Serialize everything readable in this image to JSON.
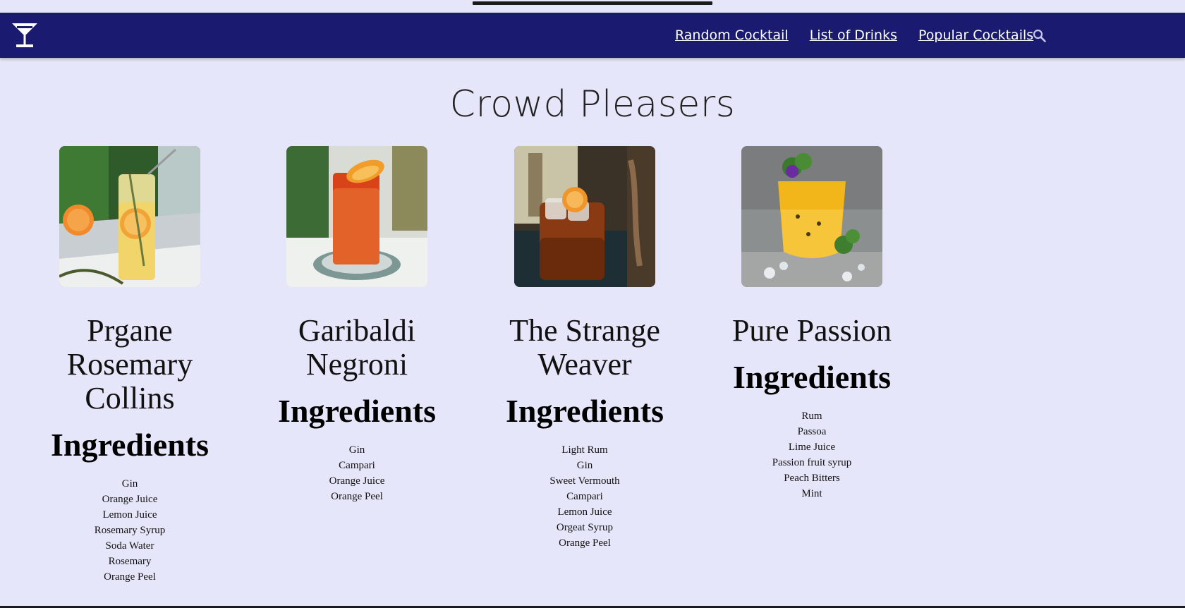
{
  "nav": {
    "links": [
      "Random Cocktail",
      "List of Drinks",
      "Popular Cocktails"
    ]
  },
  "page": {
    "title": "Crowd Pleasers"
  },
  "ingredients_heading": "Ingredients",
  "cards": [
    {
      "name": "Prgane Rosemary Collins",
      "ingredients": [
        "Gin",
        "Orange Juice",
        "Lemon Juice",
        "Rosemary Syrup",
        "Soda Water",
        "Rosemary",
        "Orange Peel"
      ]
    },
    {
      "name": "Garibaldi Negroni",
      "ingredients": [
        "Gin",
        "Campari",
        "Orange Juice",
        "Orange Peel"
      ]
    },
    {
      "name": "The Strange Weaver",
      "ingredients": [
        "Light Rum",
        "Gin",
        "Sweet Vermouth",
        "Campari",
        "Lemon Juice",
        "Orgeat Syrup",
        "Orange Peel"
      ]
    },
    {
      "name": "Pure Passion",
      "ingredients": [
        "Rum",
        "Passoa",
        "Lime Juice",
        "Passion fruit syrup",
        "Peach Bitters",
        "Mint"
      ]
    }
  ],
  "icons": {
    "logo": "cocktail-glass-icon",
    "search": "search-icon"
  },
  "colors": {
    "background": "#e6e6fa",
    "navbar": "#1a1a70",
    "nav_text": "#ffffff"
  }
}
